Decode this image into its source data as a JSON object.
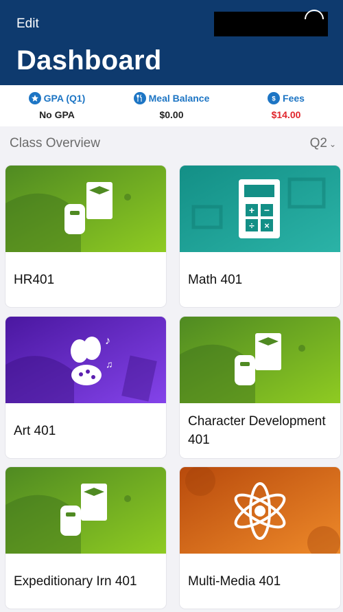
{
  "header": {
    "edit_label": "Edit",
    "title": "Dashboard"
  },
  "stats": {
    "gpa": {
      "label": "GPA (Q1)",
      "value": "No GPA",
      "icon": "star-icon"
    },
    "meal": {
      "label": "Meal Balance",
      "value": "$0.00",
      "icon": "utensils-icon"
    },
    "fees": {
      "label": "Fees",
      "value": "$14.00",
      "icon": "dollar-icon"
    }
  },
  "overview": {
    "title": "Class Overview",
    "quarter": "Q2"
  },
  "classes": [
    {
      "name": "HR401",
      "theme": "green",
      "icon": "backpack-books-icon"
    },
    {
      "name": "Math 401",
      "theme": "teal",
      "icon": "calculator-icon"
    },
    {
      "name": "Art 401",
      "theme": "purple",
      "icon": "art-masks-palette-icon"
    },
    {
      "name": "Character Development 401",
      "theme": "green",
      "icon": "backpack-books-icon"
    },
    {
      "name": "Expeditionary Irn 401",
      "theme": "green",
      "icon": "backpack-books-icon"
    },
    {
      "name": "Multi-Media 401",
      "theme": "orange",
      "icon": "atom-icon"
    }
  ],
  "colors": {
    "header": "#0e3a6e",
    "accent": "#1d75c4",
    "fees": "#e0242b",
    "green_a": "#5f9a28",
    "green_b": "#86c224",
    "teal_a": "#138f86",
    "teal_b": "#2bb0a4",
    "purple_a": "#5b1fb0",
    "purple_b": "#7c3be0",
    "orange_a": "#c5520f",
    "orange_b": "#e97a1e"
  }
}
